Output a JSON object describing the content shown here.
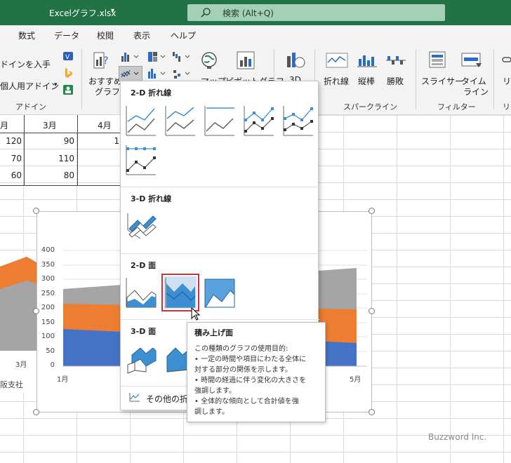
{
  "titlebar": {
    "filename": "Excelグラフ.xlsx",
    "caret": "▾",
    "search_placeholder": "検索 (Alt+Q)",
    "color": "#217346"
  },
  "ribbon": {
    "tabs": [
      "数式",
      "データ",
      "校閲",
      "表示",
      "ヘルプ"
    ],
    "addins": {
      "get_label": "ドインを入手",
      "personal_label": "個人用アドイン",
      "group_label": "アドイン"
    },
    "recommended_label_1": "おすすめ",
    "recommended_label_2": "グラフ",
    "map_label": "マップ",
    "pivot_label": "ピボットグラフ",
    "threed_label": "3D",
    "sparklines": {
      "line_label": "折れ線",
      "column_label": "縦棒",
      "winloss_label": "勝敗",
      "group_label": "スパークライン"
    },
    "filters": {
      "slicer_label": "スライサー",
      "timeline_label_1": "タイム",
      "timeline_label_2": "ライン",
      "group_label": "フィルター"
    },
    "links_label": "リ"
  },
  "sheet": {
    "headers": [
      "月",
      "3月",
      "4月"
    ],
    "rows": [
      [
        "120",
        "90",
        "1"
      ],
      [
        "70",
        "110",
        ""
      ],
      [
        "60",
        "80",
        ""
      ]
    ]
  },
  "chart": {
    "y_ticks": [
      "400",
      "350",
      "300",
      "250",
      "200",
      "150",
      "100",
      "50",
      "0"
    ],
    "x_first": "1月",
    "x_last": "5月",
    "left_x_label": "3月",
    "left_legend": "阪支社",
    "colors": {
      "blue": "#4472c4",
      "orange": "#ed7d31",
      "gray": "#a5a5a5"
    },
    "chart_data": {
      "type": "area",
      "ylim": [
        0,
        400
      ],
      "yticks": [
        0,
        50,
        100,
        150,
        200,
        250,
        300,
        350,
        400
      ]
    }
  },
  "gallery": {
    "sections": {
      "line_2d": "2-D 折れ線",
      "line_3d": "3-D 折れ線",
      "area_2d": "2-D 面",
      "area_3d": "3-D 面"
    },
    "more_label": "その他の折れ",
    "selected": "積み上げ面"
  },
  "tooltip": {
    "title": "積み上げ面",
    "lines": [
      "この種類のグラフの使用目的:",
      "• 一定の時間や項目にわたる全体に",
      "対する部分の関係を示します。",
      "• 時間の経過に伴う変化の大きさを",
      "強調します。",
      "• 全体的な傾向として合計値を強",
      "調します。"
    ]
  },
  "watermark": "Buzzword Inc."
}
